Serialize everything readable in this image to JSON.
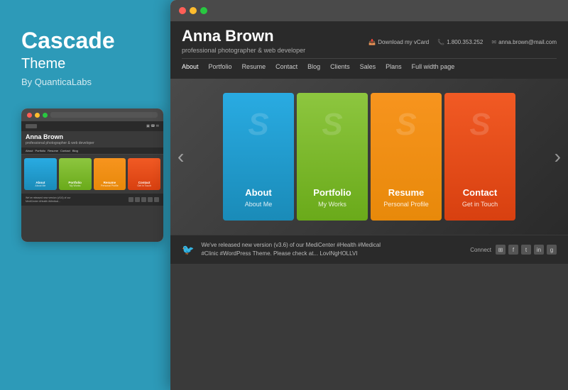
{
  "left": {
    "title": "Cascade",
    "subtitle": "Theme",
    "by": "By QuanticaLabs"
  },
  "small_preview": {
    "site_name": "Anna Brown",
    "tagline": "professional photographer & web developer",
    "cards": [
      {
        "label": "About",
        "sub": "About Me",
        "color": "#29abe2"
      },
      {
        "label": "Portfolio",
        "sub": "My Works",
        "color": "#8dc63f"
      },
      {
        "label": "Resume",
        "sub": "Personal Profile",
        "color": "#f7941e"
      },
      {
        "label": "Contact",
        "sub": "Get in Touch",
        "color": "#f15a24"
      }
    ]
  },
  "large_browser": {
    "site_name": "Anna Brown",
    "tagline": "professional photographer & web developer",
    "meta": [
      {
        "icon": "📥",
        "text": "Download my vCard"
      },
      {
        "icon": "📞",
        "text": "1.800.353.252"
      },
      {
        "icon": "✉",
        "text": "anna.brown@mail.com"
      }
    ],
    "nav": [
      {
        "label": "About",
        "active": true
      },
      {
        "label": "Portfolio",
        "active": false
      },
      {
        "label": "Resume",
        "active": false
      },
      {
        "label": "Contact",
        "active": false
      },
      {
        "label": "Blog",
        "active": false
      },
      {
        "label": "Clients",
        "active": false
      },
      {
        "label": "Sales",
        "active": false
      },
      {
        "label": "Plans",
        "active": false
      },
      {
        "label": "Full width page",
        "active": false
      }
    ],
    "cards": [
      {
        "title": "About",
        "subtitle": "About Me",
        "color_class": "card-blue"
      },
      {
        "title": "Portfolio",
        "subtitle": "My Works",
        "color_class": "card-green"
      },
      {
        "title": "Resume",
        "subtitle": "Personal Profile",
        "color_class": "card-yellow"
      },
      {
        "title": "Contact",
        "subtitle": "Get in Touch",
        "color_class": "card-orange"
      }
    ],
    "footer": {
      "tweet": "We've released new version (v3.6) of our MediCenter #Health #Medical #Clinic #WordPress Theme. Please check at... LovINgHOLLVI",
      "connect_label": "Connect"
    }
  }
}
